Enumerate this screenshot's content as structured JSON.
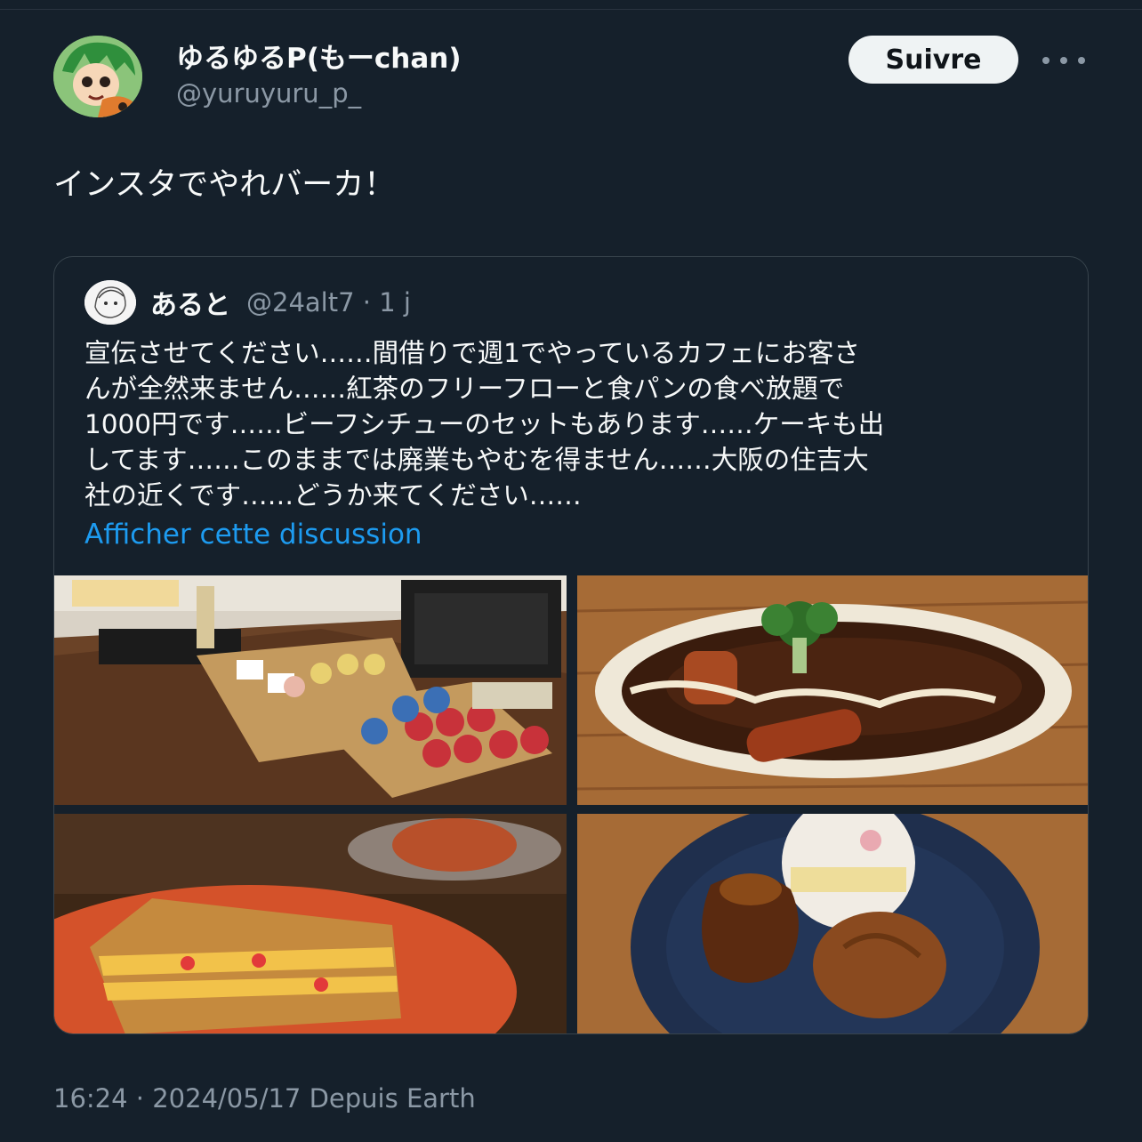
{
  "author": {
    "display_name": "ゆるゆるP(もーchan)",
    "handle": "@yuruyuru_p_"
  },
  "actions": {
    "follow_label": "Suivre",
    "more_icon": "more-horizontal-icon"
  },
  "tweet": {
    "text": "インスタでやれバーカ！"
  },
  "quoted": {
    "name": "あると",
    "meta": "@24alt7 · 1 j",
    "lines": [
      "宣伝させてください……間借りで週1でやっているカフェにお客さ",
      "んが全然来ません……紅茶のフリーフローと食パンの食べ放題で",
      "1000円です……ビーフシチューのセットもあります……ケーキも出",
      "してます……このままでは廃業もやむを得ません……大阪の住吉大",
      "社の近くです……どうか来てください……"
    ],
    "link": "Afficher cette discussion"
  },
  "footer": {
    "meta": "16:24 · 2024/05/17 Depuis Earth"
  },
  "colors": {
    "background": "#15202b",
    "text": "#f7f9f9",
    "secondary": "#8b98a5",
    "link": "#1d9bf0",
    "border": "#38444d"
  }
}
